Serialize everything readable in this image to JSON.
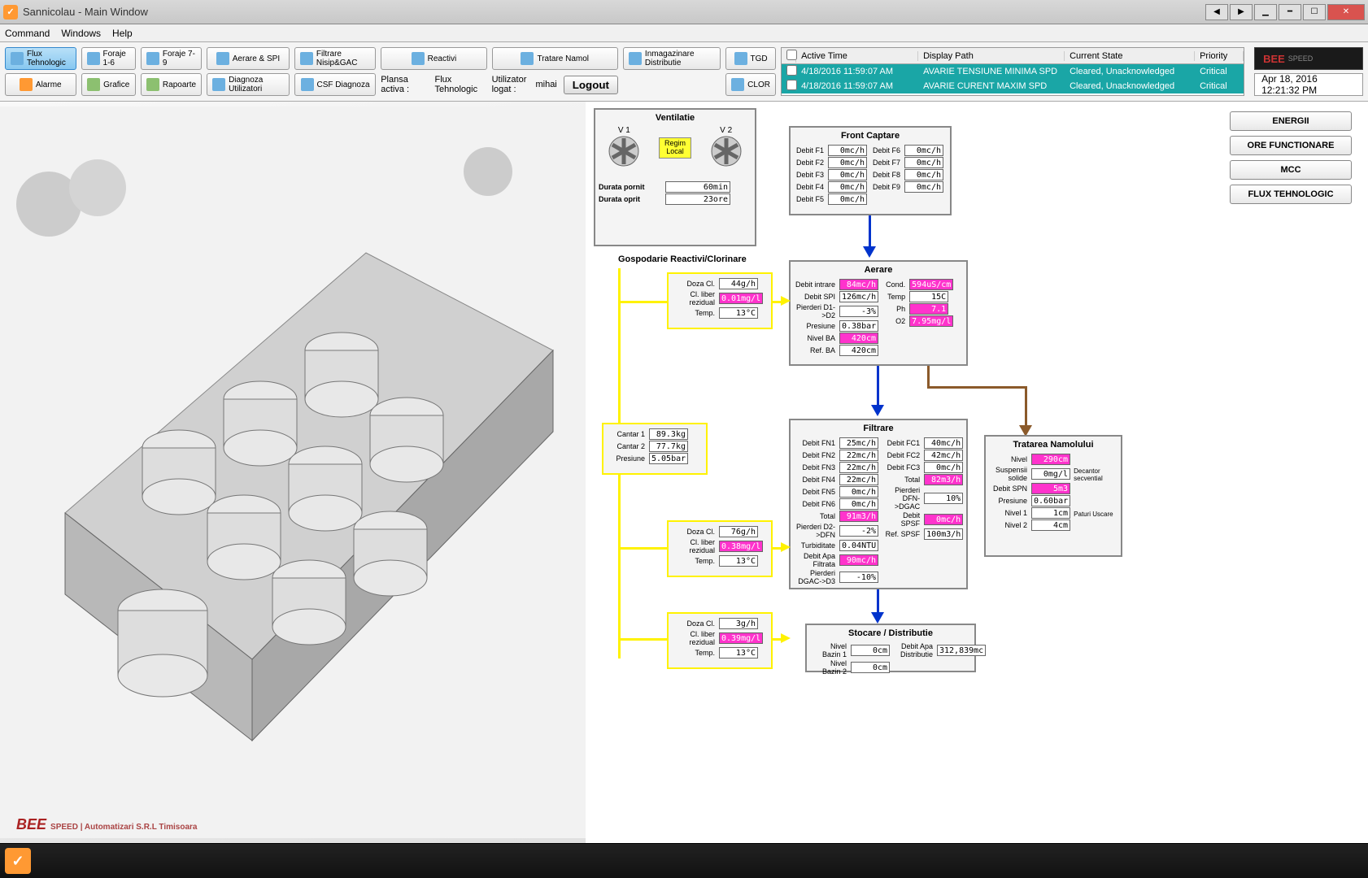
{
  "window": {
    "title": "Sannicolau - Main Window"
  },
  "menu": {
    "command": "Command",
    "windows": "Windows",
    "help": "Help"
  },
  "toolbar": {
    "flux": "Flux Tehnologic",
    "flux2": "Flux\nTehnologic",
    "foraje16": "Foraje 1-6",
    "foraje79": "Foraje 7-9",
    "aerare": "Aerare & SPI",
    "filtrare": "Filtrare Nisip&GAC",
    "reactivi": "Reactivi",
    "tratare": "Tratare Namol",
    "inmag": "Inmagazinare Distributie",
    "tgd": "TGD",
    "alarme": "Alarme",
    "grafice": "Grafice",
    "rapoarte": "Rapoarte",
    "diagu": "Diagnoza Utilizatori",
    "csf": "CSF Diagnoza",
    "clor": "CLOR",
    "plansa_lbl": "Plansa activa :",
    "plansa_val": "Flux Tehnologic",
    "user_lbl": "Utilizator logat :",
    "user_val": "mihai",
    "logout": "Logout"
  },
  "alarms": {
    "hdr": {
      "active": "Active Time",
      "path": "Display Path",
      "state": "Current State",
      "priority": "Priority"
    },
    "rows": [
      {
        "time": "4/18/2016 11:59:07 AM",
        "path": "AVARIE  TENSIUNE MINIMA SPD",
        "state": "Cleared, Unacknowledged",
        "pri": "Critical"
      },
      {
        "time": "4/18/2016 11:59:07 AM",
        "path": "AVARIE  CURENT MAXIM SPD",
        "state": "Cleared, Unacknowledged",
        "pri": "Critical"
      }
    ]
  },
  "logo": {
    "big": "BEE",
    "small": "SPEED"
  },
  "datetime": "Apr 18, 2016 12:21:32 PM",
  "sidebtns": {
    "energii": "ENERGII",
    "ore": "ORE FUNCTIONARE",
    "mcc": "MCC",
    "fluxt": "FLUX TEHNOLOGIC"
  },
  "ventilatie": {
    "title": "Ventilatie",
    "v1": "V 1",
    "v2": "V 2",
    "regim": "Regim Local",
    "durata_pornit_lbl": "Durata pornit",
    "durata_pornit": "60min",
    "durata_oprit_lbl": "Durata oprit",
    "durata_oprit": "23ore"
  },
  "gospodarie": {
    "title": "Gospodarie Reactivi/Clorinare"
  },
  "front": {
    "title": "Front Captare",
    "items": [
      {
        "l": "Debit F1",
        "v": "0mc/h"
      },
      {
        "l": "Debit F2",
        "v": "0mc/h"
      },
      {
        "l": "Debit F3",
        "v": "0mc/h"
      },
      {
        "l": "Debit F4",
        "v": "0mc/h"
      },
      {
        "l": "Debit F5",
        "v": "0mc/h"
      }
    ],
    "items2": [
      {
        "l": "Debit F6",
        "v": "0mc/h"
      },
      {
        "l": "Debit F7",
        "v": "0mc/h"
      },
      {
        "l": "Debit F8",
        "v": "0mc/h"
      },
      {
        "l": "Debit F9",
        "v": "0mc/h"
      }
    ]
  },
  "aerare": {
    "title": "Aerare",
    "left": [
      {
        "l": "Debit intrare",
        "v": "84mc/h",
        "c": "pink"
      },
      {
        "l": "Debit SPI",
        "v": "126mc/h",
        "c": ""
      },
      {
        "l": "Pierderi D1->D2",
        "v": "-3%",
        "c": ""
      },
      {
        "l": "Presiune",
        "v": "0.38bar",
        "c": ""
      },
      {
        "l": "Nivel BA",
        "v": "420cm",
        "c": "pink"
      },
      {
        "l": "Ref. BA",
        "v": "420cm",
        "c": ""
      }
    ],
    "right": [
      {
        "l": "Cond.",
        "v": "594uS/cm",
        "c": "pink"
      },
      {
        "l": "Temp",
        "v": "15C",
        "c": ""
      },
      {
        "l": "Ph",
        "v": "7.1",
        "c": "pink"
      },
      {
        "l": "O2",
        "v": "7.95mg/l",
        "c": "pink"
      }
    ]
  },
  "reactivi1": {
    "rows": [
      {
        "l": "Doza Cl.",
        "v": "44g/h",
        "c": ""
      },
      {
        "l": "Cl. liber rezidual",
        "v": "0.01mg/l",
        "c": "pink"
      },
      {
        "l": "Temp.",
        "v": "13°C",
        "c": ""
      }
    ]
  },
  "cantar": {
    "rows": [
      {
        "l": "Cantar 1",
        "v": "89.3kg"
      },
      {
        "l": "Cantar 2",
        "v": "77.7kg"
      },
      {
        "l": "Presiune",
        "v": "5.05bar"
      }
    ]
  },
  "reactivi2": {
    "rows": [
      {
        "l": "Doza Cl.",
        "v": "76g/h",
        "c": ""
      },
      {
        "l": "Cl. liber rezidual",
        "v": "0.38mg/l",
        "c": "pink"
      },
      {
        "l": "Temp.",
        "v": "13°C",
        "c": ""
      }
    ]
  },
  "reactivi3": {
    "rows": [
      {
        "l": "Doza Cl.",
        "v": "3g/h",
        "c": ""
      },
      {
        "l": "Cl. liber rezidual",
        "v": "0.39mg/l",
        "c": "pink"
      },
      {
        "l": "Temp.",
        "v": "13°C",
        "c": ""
      }
    ]
  },
  "filtrare": {
    "title": "Filtrare",
    "left": [
      {
        "l": "Debit FN1",
        "v": "25mc/h",
        "c": ""
      },
      {
        "l": "Debit FN2",
        "v": "22mc/h",
        "c": ""
      },
      {
        "l": "Debit FN3",
        "v": "22mc/h",
        "c": ""
      },
      {
        "l": "Debit FN4",
        "v": "22mc/h",
        "c": ""
      },
      {
        "l": "Debit FN5",
        "v": "0mc/h",
        "c": ""
      },
      {
        "l": "Debit FN6",
        "v": "0mc/h",
        "c": ""
      },
      {
        "l": "Total",
        "v": "91m3/h",
        "c": "pink"
      },
      {
        "l": "Pierderi D2->DFN",
        "v": "-2%",
        "c": ""
      },
      {
        "l": "Turbiditate",
        "v": "0.04NTU",
        "c": ""
      },
      {
        "l": "Debit Apa Filtrata",
        "v": "90mc/h",
        "c": "pink"
      },
      {
        "l": "Pierderi DGAC->D3",
        "v": "-10%",
        "c": ""
      }
    ],
    "right": [
      {
        "l": "Debit FC1",
        "v": "40mc/h",
        "c": ""
      },
      {
        "l": "Debit FC2",
        "v": "42mc/h",
        "c": ""
      },
      {
        "l": "Debit FC3",
        "v": "0mc/h",
        "c": ""
      },
      {
        "l": "Total",
        "v": "82m3/h",
        "c": "pink"
      },
      {
        "l": "Pierderi DFN->DGAC",
        "v": "10%",
        "c": ""
      },
      {
        "l": "Debit SPSF",
        "v": "0mc/h",
        "c": "pink"
      },
      {
        "l": "Ref. SPSF",
        "v": "100m3/h",
        "c": ""
      }
    ]
  },
  "namol": {
    "title": "Tratarea Namolului",
    "rows": [
      {
        "l": "Nivel",
        "v": "290cm",
        "c": "pink"
      },
      {
        "l": "Suspensii solide",
        "v": "0mg/l",
        "c": ""
      },
      {
        "l": "Debit SPN",
        "v": "5m3",
        "c": "pink"
      },
      {
        "l": "Presiune",
        "v": "0.60bar",
        "c": ""
      },
      {
        "l": "Nivel 1",
        "v": "1cm",
        "c": ""
      },
      {
        "l": "Nivel 2",
        "v": "4cm",
        "c": ""
      }
    ],
    "side1": "Decantor secvential",
    "side2": "Paturi Uscare"
  },
  "stocare": {
    "title": "Stocare / Distributie",
    "rows": [
      {
        "l": "Nivel Bazin 1",
        "v": "0cm"
      },
      {
        "l": "Nivel Bazin 2",
        "v": "0cm"
      }
    ],
    "right": [
      {
        "l": "Debit Apa Distributie",
        "v": "312,839mc"
      }
    ]
  }
}
